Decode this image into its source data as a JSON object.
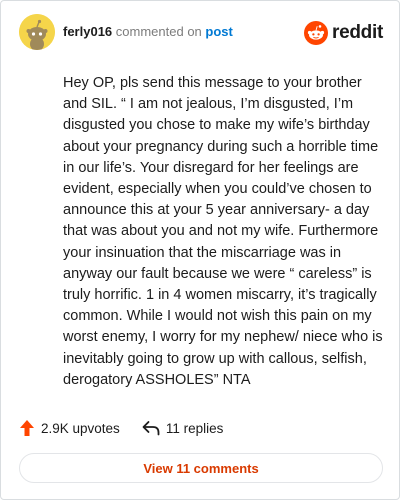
{
  "header": {
    "username": "ferly016",
    "action_text": "commented on",
    "target_link": "post",
    "brand": "reddit"
  },
  "comment": {
    "body": "Hey OP, pls send this message to your brother and SIL. “ I am not jealous, I’m disgusted, I’m disgusted you chose to make my wife’s birthday about your pregnancy during such a horrible time in our life’s. Your disregard for her feelings are evident, especially when you could’ve chosen to announce this at your 5 year anniversary- a day that was about you and not my wife. Furthermore your insinuation that the miscarriage was in anyway our fault because we were “ careless” is truly horrific. 1 in 4 women miscarry, it’s tragically common. While I would not wish this pain on my worst enemy, I worry for my nephew/ niece who is inevitably going to grow up with callous, selfish, derogatory ASSHOLES” NTA"
  },
  "stats": {
    "upvotes": "2.9K upvotes",
    "replies": "11 replies"
  },
  "footer": {
    "view_comments_label": "View 11 comments"
  },
  "colors": {
    "accent": "#ff4500",
    "link": "#0079d3",
    "button_text": "#d93a00",
    "avatar_bg": "#f5d54a"
  },
  "icons": [
    "snoo-avatar-icon",
    "reddit-logo-icon",
    "upvote-arrow-icon",
    "reply-arrow-icon"
  ]
}
